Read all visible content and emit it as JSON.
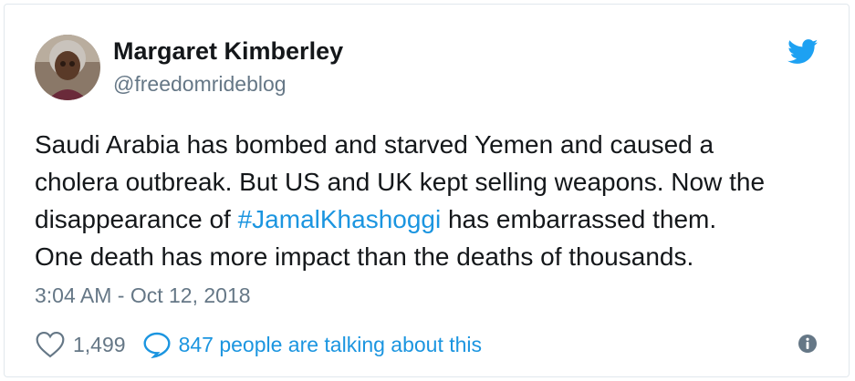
{
  "tweet": {
    "author_name": "Margaret Kimberley",
    "author_handle": "@freedomrideblog",
    "text_lines": [
      {
        "before": "Saudi Arabia has bombed and starved Yemen and caused a"
      },
      {
        "before": "cholera outbreak. But US and UK kept selling weapons. Now the"
      },
      {
        "before": "disappearance of ",
        "hashtag": "#JamalKhashoggi",
        "after": " has embarrassed them."
      },
      {
        "before": "One death has more impact than the deaths of thousands."
      }
    ],
    "timestamp": "3:04 AM - Oct 12, 2018",
    "like_count": "1,499",
    "talking_text": "847 people are talking about this"
  },
  "icons": {
    "brand": "twitter-bird-icon",
    "like": "heart-icon",
    "reply": "speech-bubble-icon",
    "info": "info-icon"
  },
  "colors": {
    "accent": "#1b95e0",
    "bird": "#1da1f2",
    "text": "#14171a",
    "muted": "#657786",
    "border": "#e1e8ed"
  }
}
